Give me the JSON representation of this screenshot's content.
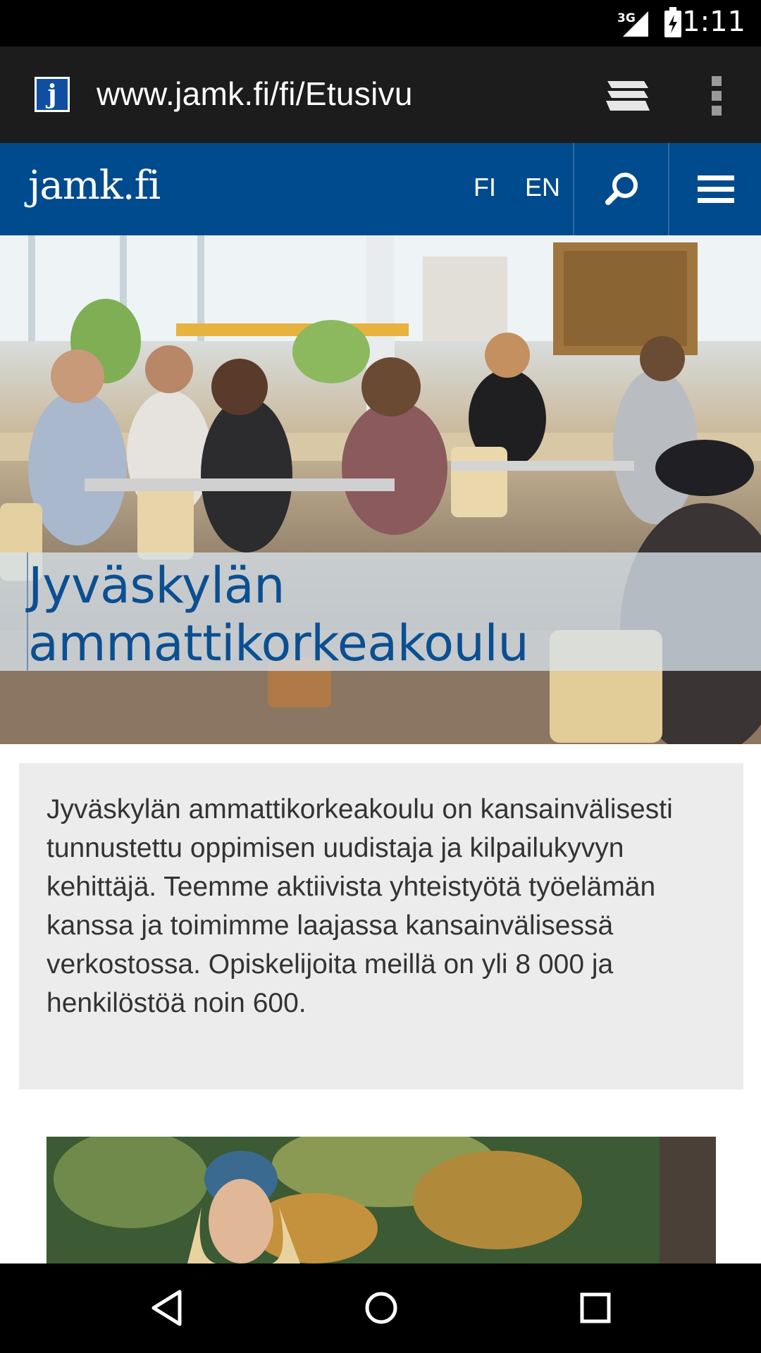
{
  "status_bar": {
    "network": "3G",
    "time": "1:11"
  },
  "browser": {
    "url": "www.jamk.fi/fi/Etusivu",
    "favicon_letter": "j",
    "icons": [
      "tabs-icon",
      "overflow-menu-icon"
    ]
  },
  "site_header": {
    "logo": "jamk.fi",
    "languages": [
      "FI",
      "EN"
    ],
    "icons": [
      "search-icon",
      "hamburger-menu-icon"
    ],
    "background_color": "#004b8d"
  },
  "hero": {
    "title_line1": "Jyväskylän",
    "title_line2": "ammattikorkeakoulu",
    "title_color": "#0b4f91"
  },
  "intro": {
    "text": "Jyväskylän ammattikorkeakoulu on kansainvälisesti tunnustettu oppimisen uudistaja ja kilpailukyvyn kehittäjä. Teemme aktiivista yhteistyötä työelämän kanssa ja toimimme laajassa kansainvälisessä verkostossa. Opiskelijoita meillä on yli 8 000 ja henkilöstöä noin 600."
  },
  "nav_bar": {
    "icons": [
      "back-icon",
      "home-icon",
      "recents-icon"
    ]
  }
}
